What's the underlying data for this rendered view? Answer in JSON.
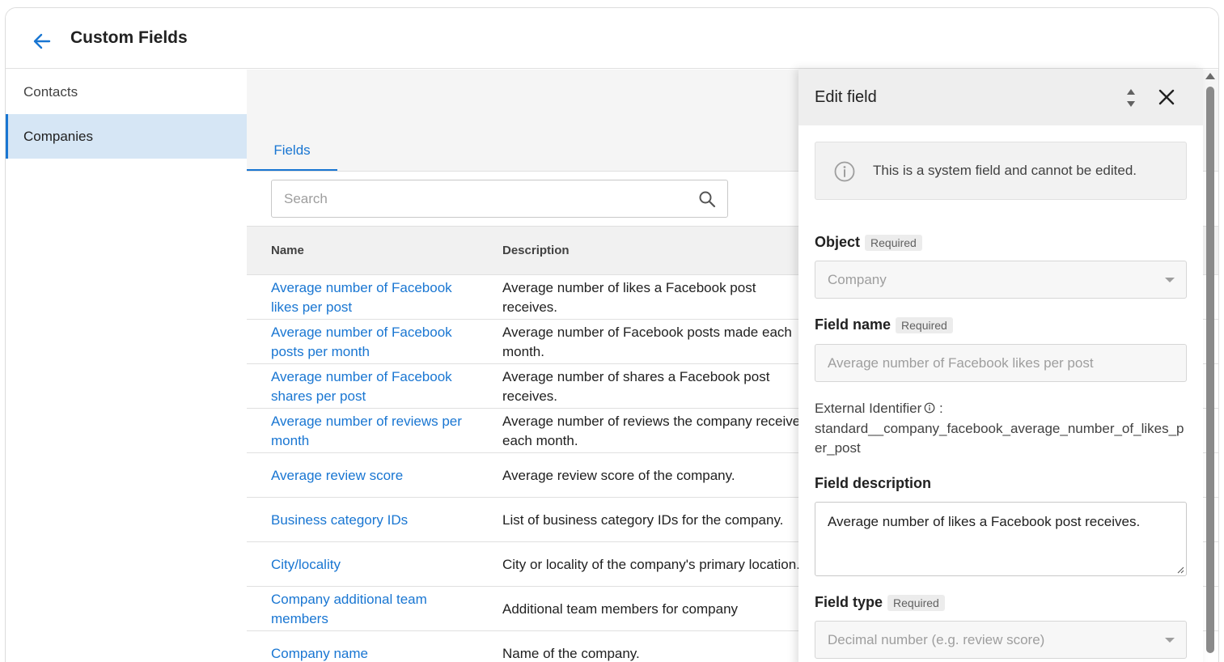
{
  "header": {
    "title": "Custom Fields",
    "back_icon": "arrow-left-icon"
  },
  "sidebar": {
    "items": [
      {
        "label": "Contacts",
        "active": false
      },
      {
        "label": "Companies",
        "active": true
      }
    ]
  },
  "tabs": [
    {
      "label": "Fields",
      "active": true
    }
  ],
  "search": {
    "placeholder": "Search",
    "value": ""
  },
  "table": {
    "columns": [
      "Name",
      "Description"
    ],
    "rows": [
      {
        "name": "Average number of Facebook likes per post",
        "description": "Average number of likes a Facebook post receives."
      },
      {
        "name": "Average number of Facebook posts per month",
        "description": "Average number of Facebook posts made each month."
      },
      {
        "name": "Average number of Facebook shares per post",
        "description": "Average number of shares a Facebook post receives."
      },
      {
        "name": "Average number of reviews per month",
        "description": "Average number of reviews the company receives each month."
      },
      {
        "name": "Average review score",
        "description": "Average review score of the company."
      },
      {
        "name": "Business category IDs",
        "description": "List of business category IDs for the company."
      },
      {
        "name": "City/locality",
        "description": "City or locality of the company's primary location."
      },
      {
        "name": "Company additional team members",
        "description": "Additional team members for company"
      },
      {
        "name": "Company name",
        "description": "Name of the company."
      }
    ]
  },
  "edit_panel": {
    "title": "Edit field",
    "info_message": "This is a system field and cannot be edited.",
    "required_tag": "Required",
    "object": {
      "label": "Object",
      "value": "Company"
    },
    "field_name": {
      "label": "Field name",
      "value": "Average number of Facebook likes per post"
    },
    "external_identifier": {
      "label": "External Identifier",
      "separator": " :",
      "value": "standard__company_facebook_average_number_of_likes_per_post"
    },
    "field_description": {
      "label": "Field description",
      "value": "Average number of likes a Facebook post receives."
    },
    "field_type": {
      "label": "Field type",
      "value": "Decimal number (e.g. review score)"
    }
  },
  "colors": {
    "accent": "#1976d2",
    "active_nav_bg": "#d6e6f5",
    "panel_header_bg": "#eeeeee"
  }
}
